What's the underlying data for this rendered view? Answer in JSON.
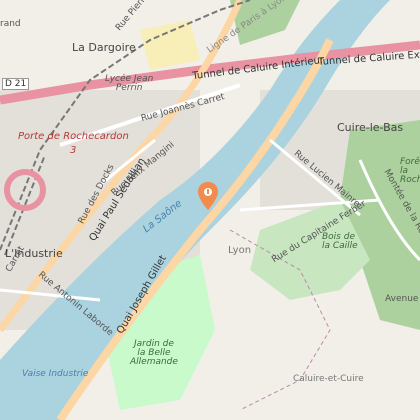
{
  "map": {
    "places": {
      "dargoire": "La Dargoire",
      "cuire_le_bas": "Cuire-le-Bas",
      "industrie": "L'Industrie",
      "lyon": "Lyon",
      "caluire": "Caluire-et-Cuire"
    },
    "water": {
      "river": "La Saône"
    },
    "roads": {
      "quai_sedaillan": "Quai Paul Sédallian",
      "quai_gillet": "Quai Joseph Gillet",
      "tunnel_int": "Tunnel de Caluire Intérieur",
      "tunnel_ext": "Tunnel de Caluire Exté",
      "joannes_carret": "Rue Joannès Carret",
      "felix_mangini": "Rue Félix Mangini",
      "docks": "Rue des Docks",
      "antonin_laborde": "Rue Antonin Laborde",
      "lucien_mainre": "Rue Lucien Mainre",
      "capitaine_ferber": "Rue du Capitaine Ferber",
      "montee_rochette": "Montée de la Rochette",
      "avenue": "Avenue",
      "carret": "Carret",
      "pierre": "Rue Pierre",
      "rand": "rand",
      "rail_line": "Ligne de Paris à Lyon",
      "shield_d21": "D 21"
    },
    "pois": {
      "lycee": "Lycée Jean\nPerrin",
      "porte_rochecardon": "Porte de Rochecardon",
      "porte_num": "3",
      "bois_caille": "Bois de\nla Caille",
      "jardin": "Jardin de\nla Belle\nAllemande",
      "vaise_industrie": "Vaise Industrie",
      "foret": "Forêt\nla\nRoch"
    },
    "colors": {
      "water": "#aad3df",
      "motorway": "#e892a2",
      "trunk": "#f9b29c",
      "primary": "#fcd6a4",
      "park": "#c8facc",
      "forest": "#add19e",
      "marker": "#f28b4b"
    }
  }
}
